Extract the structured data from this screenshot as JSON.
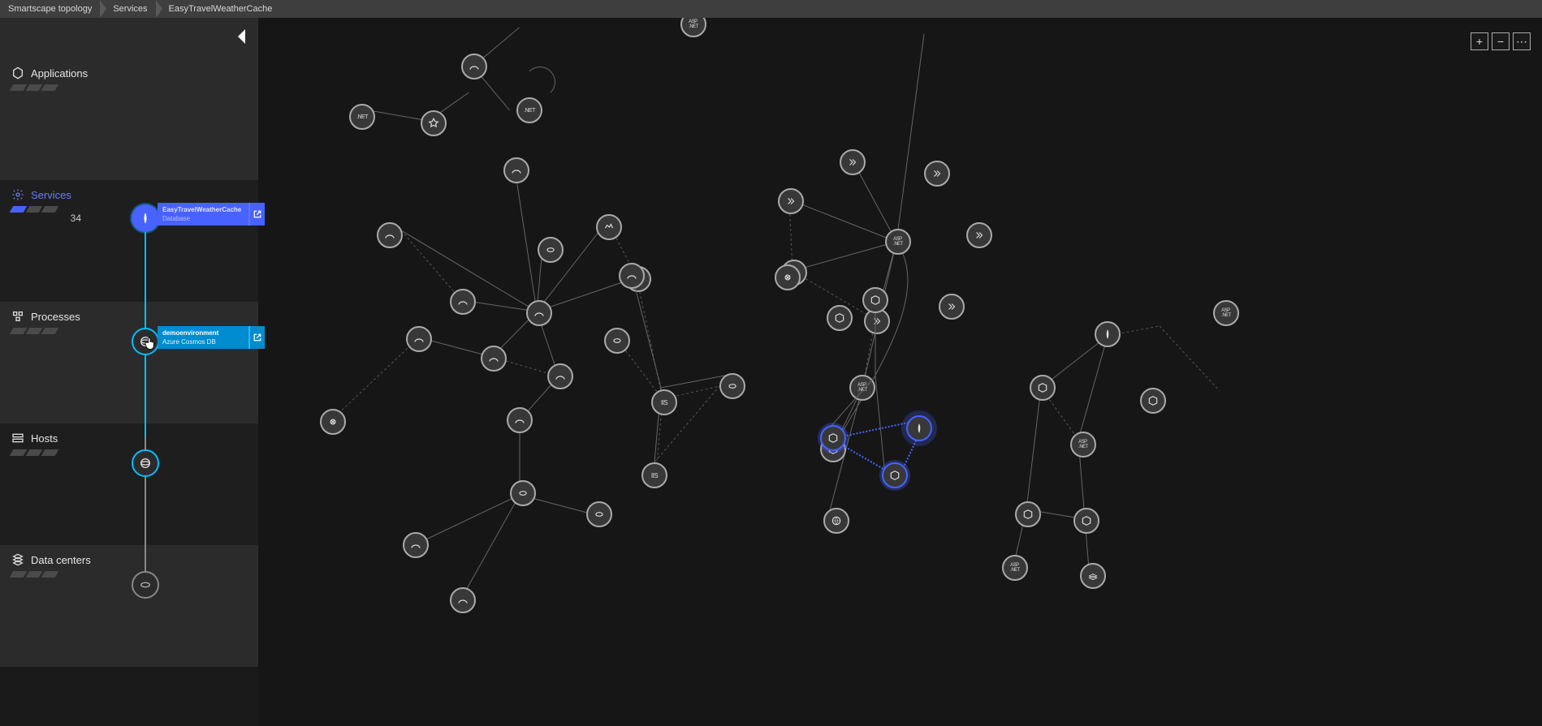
{
  "breadcrumb": {
    "items": [
      "Smartscape topology",
      "Services",
      "EasyTravelWeatherCache"
    ]
  },
  "sidebar": {
    "layers": [
      {
        "id": "applications",
        "label": "Applications",
        "count": "",
        "active": false
      },
      {
        "id": "services",
        "label": "Services",
        "count": "34",
        "active": true
      },
      {
        "id": "processes",
        "label": "Processes",
        "count": "",
        "active": false
      },
      {
        "id": "hosts",
        "label": "Hosts",
        "count": "",
        "active": false
      },
      {
        "id": "datacenters",
        "label": "Data centers",
        "count": "",
        "active": false
      }
    ],
    "cards": {
      "service": {
        "title": "EasyTravelWeatherCache",
        "subtitle": "Database"
      },
      "process": {
        "title": "demoenvironment",
        "subtitle": "Azure Cosmos DB"
      }
    }
  },
  "zoom": {
    "in": "+",
    "out": "−",
    "more": "⋯"
  },
  "icons": {
    "hexagon": "hexagon",
    "gear": "gear",
    "cube": "cube",
    "host": "host",
    "dc": "datacenter"
  },
  "topology": {
    "selected_entity": "EasyTravelWeatherCache",
    "selected_type": "Database service"
  }
}
